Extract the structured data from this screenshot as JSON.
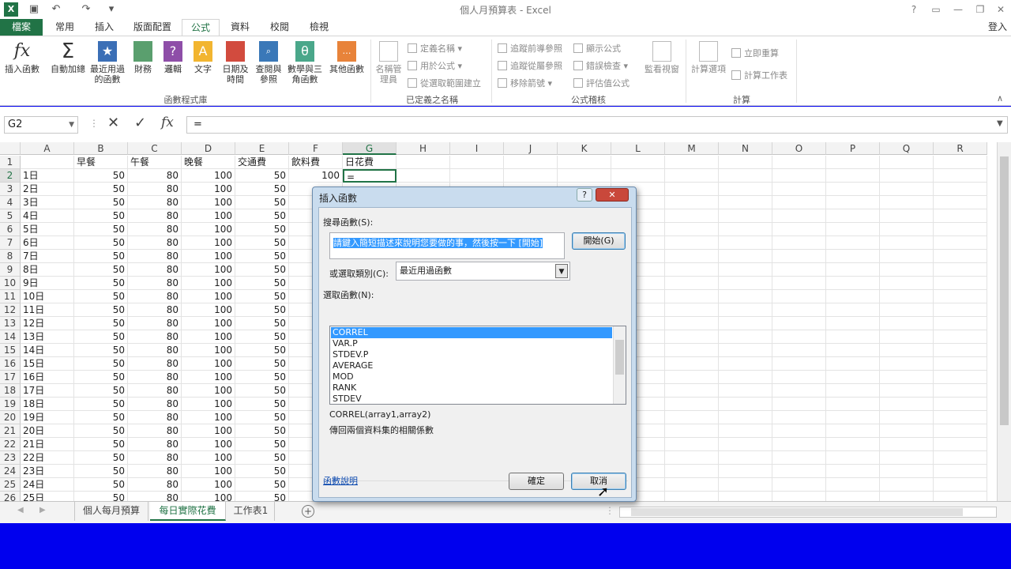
{
  "window": {
    "title": "個人月預算表 - Excel",
    "user": "登入"
  },
  "tabs": [
    "檔案",
    "常用",
    "插入",
    "版面配置",
    "公式",
    "資料",
    "校閱",
    "檢視"
  ],
  "ribbon": {
    "function_library": {
      "label": "函數程式庫",
      "buttons": [
        "插入函數",
        "自動加總",
        "最近用過的函數",
        "財務",
        "邏輯",
        "文字",
        "日期及時間",
        "查閱與參照",
        "數學與三角函數",
        "其他函數"
      ]
    },
    "defined_names": {
      "label": "已定義之名稱",
      "name_manager": "名稱管理員",
      "items": [
        "定義名稱",
        "用於公式",
        "從選取範圍建立"
      ]
    },
    "formula_auditing": {
      "label": "公式稽核",
      "items": [
        "追蹤前導參照",
        "顯示公式",
        "追蹤從屬參照",
        "錯誤檢查",
        "移除箭號",
        "評估值公式"
      ],
      "watch": "監看視窗"
    },
    "calculation": {
      "label": "計算",
      "options": "計算選項",
      "items": [
        "立即重算",
        "計算工作表"
      ]
    }
  },
  "formula_bar": {
    "namebox": "G2",
    "formula": "="
  },
  "columns": [
    "A",
    "B",
    "C",
    "D",
    "E",
    "F",
    "G",
    "H",
    "I",
    "J",
    "K",
    "L",
    "M",
    "N",
    "O",
    "P",
    "Q",
    "R"
  ],
  "headers_row1": [
    "",
    "早餐",
    "午餐",
    "晚餐",
    "交通費",
    "飲料費",
    "日花費"
  ],
  "rows": [
    [
      "1日",
      "50",
      "80",
      "100",
      "50",
      "100",
      "="
    ],
    [
      "2日",
      "50",
      "80",
      "100",
      "50",
      "",
      ""
    ],
    [
      "3日",
      "50",
      "80",
      "100",
      "50",
      "",
      ""
    ],
    [
      "4日",
      "50",
      "80",
      "100",
      "50",
      "",
      ""
    ],
    [
      "5日",
      "50",
      "80",
      "100",
      "50",
      "",
      ""
    ],
    [
      "6日",
      "50",
      "80",
      "100",
      "50",
      "",
      ""
    ],
    [
      "7日",
      "50",
      "80",
      "100",
      "50",
      "",
      ""
    ],
    [
      "8日",
      "50",
      "80",
      "100",
      "50",
      "",
      ""
    ],
    [
      "9日",
      "50",
      "80",
      "100",
      "50",
      "",
      ""
    ],
    [
      "10日",
      "50",
      "80",
      "100",
      "50",
      "",
      ""
    ],
    [
      "11日",
      "50",
      "80",
      "100",
      "50",
      "",
      ""
    ],
    [
      "12日",
      "50",
      "80",
      "100",
      "50",
      "",
      ""
    ],
    [
      "13日",
      "50",
      "80",
      "100",
      "50",
      "",
      ""
    ],
    [
      "14日",
      "50",
      "80",
      "100",
      "50",
      "",
      ""
    ],
    [
      "15日",
      "50",
      "80",
      "100",
      "50",
      "",
      ""
    ],
    [
      "16日",
      "50",
      "80",
      "100",
      "50",
      "",
      ""
    ],
    [
      "17日",
      "50",
      "80",
      "100",
      "50",
      "",
      ""
    ],
    [
      "18日",
      "50",
      "80",
      "100",
      "50",
      "",
      ""
    ],
    [
      "19日",
      "50",
      "80",
      "100",
      "50",
      "",
      ""
    ],
    [
      "20日",
      "50",
      "80",
      "100",
      "50",
      "",
      ""
    ],
    [
      "21日",
      "50",
      "80",
      "100",
      "50",
      "",
      ""
    ],
    [
      "22日",
      "50",
      "80",
      "100",
      "50",
      "",
      ""
    ],
    [
      "23日",
      "50",
      "80",
      "100",
      "50",
      "",
      ""
    ],
    [
      "24日",
      "50",
      "80",
      "100",
      "50",
      "",
      ""
    ],
    [
      "25日",
      "50",
      "80",
      "100",
      "50",
      "",
      ""
    ]
  ],
  "sheets": [
    "個人每月預算",
    "每日實際花費",
    "工作表1"
  ],
  "dialog": {
    "title": "插入函數",
    "search_label": "搜尋函數(S):",
    "search_value": "請鍵入簡短描述來說明您要做的事，然後按一下 [開始]",
    "go_button": "開始(G)",
    "category_label": "或選取類別(C):",
    "category_value": "最近用過函數",
    "select_label": "選取函數(N):",
    "functions": [
      "CORREL",
      "VAR.P",
      "STDEV.P",
      "AVERAGE",
      "MOD",
      "RANK",
      "STDEV"
    ],
    "signature": "CORREL(array1,array2)",
    "description": "傳回兩個資料集的相關係數",
    "help_link": "函數說明",
    "ok": "確定",
    "cancel": "取消"
  },
  "colors": {
    "excel_green": "#217346",
    "selection_blue": "#3399ff",
    "taskbar_blue": "#0000ee"
  }
}
